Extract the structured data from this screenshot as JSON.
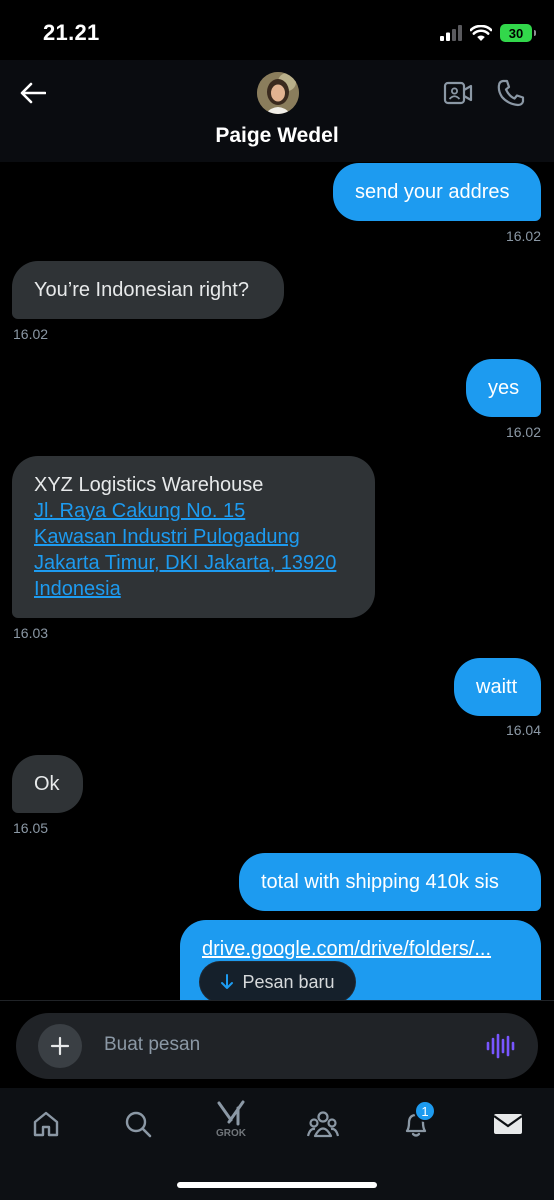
{
  "status_bar": {
    "time": "21.21",
    "battery": "30"
  },
  "header": {
    "contact_name": "Paige Wedel"
  },
  "messages": [
    {
      "text": "send your addres",
      "time": "16.02"
    },
    {
      "text": "You’re Indonesian right?",
      "time": "16.02"
    },
    {
      "text": "yes",
      "time": "16.02"
    },
    {
      "title": "XYZ Logistics Warehouse",
      "lines": [
        "Jl. Raya Cakung No. 15",
        "Kawasan Industri Pulogadung",
        "Jakarta Timur, DKI Jakarta, 13920",
        "Indonesia"
      ],
      "time": "16.03"
    },
    {
      "text": "waitt",
      "time": "16.04"
    },
    {
      "text": "Ok",
      "time": "16.05"
    },
    {
      "text": "total with shipping 410k sis"
    },
    {
      "text": "drive.google.com/drive/folders/..."
    }
  ],
  "new_message_pill": {
    "label": "Pesan baru"
  },
  "composer": {
    "placeholder": "Buat pesan"
  },
  "bottom_nav": {
    "grok_label": "GROK",
    "notification_count": "1"
  },
  "icons": [
    "back-arrow-icon",
    "video-call-icon",
    "phone-icon",
    "plus-icon",
    "voice-icon",
    "home-icon",
    "search-icon",
    "grok-icon",
    "communities-icon",
    "bell-icon",
    "mail-icon",
    "arrow-down-icon"
  ],
  "colors": {
    "sent_bubble": "#1d9bf0",
    "received_bubble": "#2f3336",
    "background": "#000000",
    "link": "#1d9bf0"
  }
}
